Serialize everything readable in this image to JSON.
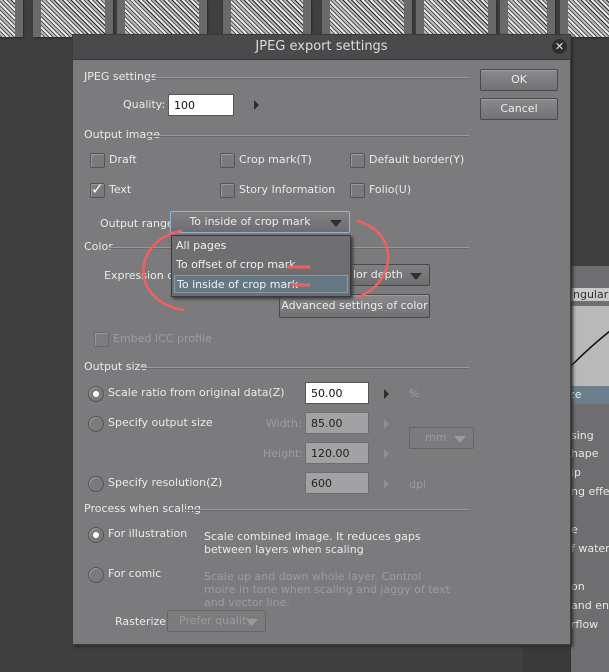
{
  "background": {
    "thumbnails": 8,
    "right_panel": {
      "header": "ngular",
      "selected_item": "ze",
      "items": [
        "sing",
        "hape",
        "ip",
        "ng effect",
        "e",
        "f waterc",
        "on",
        "and end",
        "rflow"
      ]
    }
  },
  "dialog": {
    "title": "JPEG export settings",
    "close_icon": "✕",
    "buttons": {
      "ok": "OK",
      "cancel": "Cancel"
    },
    "jpeg_settings": {
      "section": "JPEG settings",
      "quality_label": "Quality:",
      "quality_value": "100"
    },
    "output_image": {
      "section": "Output image",
      "checkboxes": [
        {
          "label": "Draft",
          "checked": false
        },
        {
          "label": "Crop mark(T)",
          "checked": false
        },
        {
          "label": "Default border(Y)",
          "checked": false
        },
        {
          "label": "Text",
          "checked": true
        },
        {
          "label": "Story Information",
          "checked": false
        },
        {
          "label": "Folio(U)",
          "checked": false
        }
      ],
      "output_range_label": "Output range:",
      "output_range_value": "To inside of crop mark",
      "output_range_options": [
        "All pages",
        "To offset of crop mark",
        "To inside of crop mark"
      ],
      "output_range_selected_index": 2
    },
    "color": {
      "section": "Color",
      "expression_label": "Expression co",
      "expression_value": "lor depth",
      "advanced_button": "Advanced settings of color",
      "embed_icc_label": "Embed ICC profile",
      "embed_icc_checked": false
    },
    "output_size": {
      "section": "Output size",
      "scale_ratio_label": "Scale ratio from original data(Z)",
      "scale_ratio_value": "50.00",
      "scale_ratio_unit": "%",
      "specify_size_label": "Specify output size",
      "width_label": "Width:",
      "width_value": "85.00",
      "height_label": "Height:",
      "height_value": "120.00",
      "unit_value": "mm",
      "specify_resolution_label": "Specify resolution(Z)",
      "resolution_value": "600",
      "resolution_unit": "dpi",
      "selected": "scale_ratio"
    },
    "process_when_scaling": {
      "section": "Process when scaling",
      "for_illustration_label": "For illustration",
      "for_illustration_desc": "Scale combined image. It reduces gaps between layers when scaling",
      "for_comic_label": "For comic",
      "for_comic_desc": "Scale up and down whole layer. Control moire in tone when scaling and jaggy of text and vector line.",
      "selected": "for_illustration",
      "rasterize_label": "Rasterize:",
      "rasterize_value": "Prefer quality"
    }
  },
  "annotation": {
    "color": "#f06060"
  }
}
